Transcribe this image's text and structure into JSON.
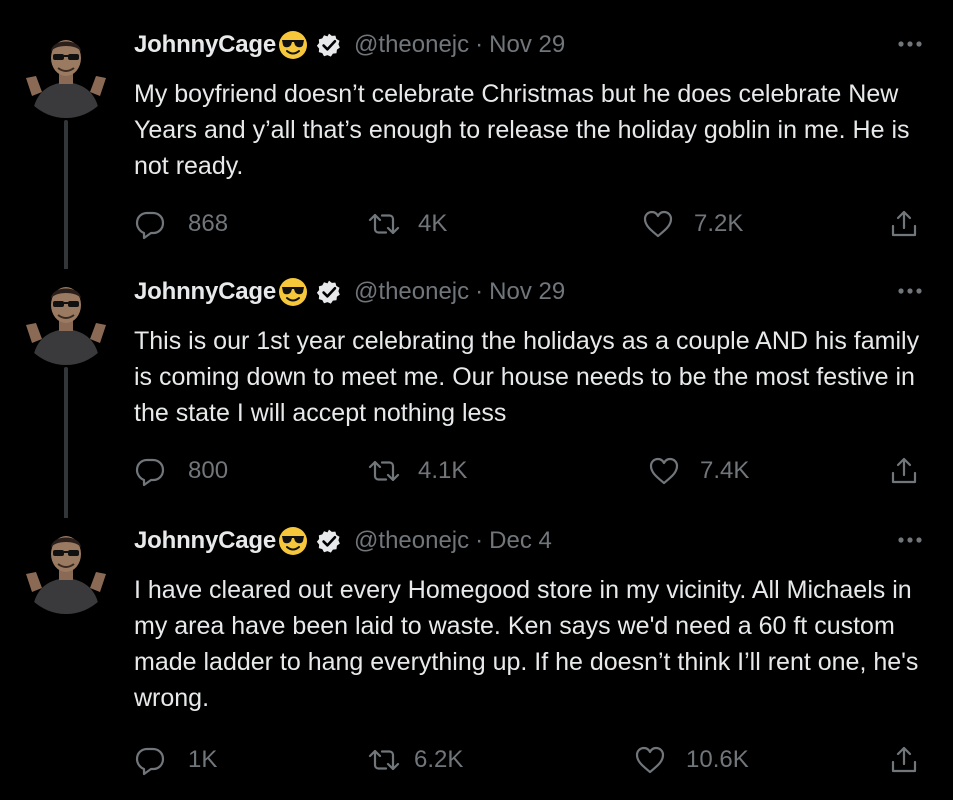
{
  "tweets": [
    {
      "name": "JohnnyCage",
      "handle": "@theonejc",
      "separator": "·",
      "date": "Nov 29",
      "text": "My boyfriend doesn’t celebrate Christmas but he does celebrate New Years and y’all that’s enough to release the holiday goblin in me. He is not ready.",
      "replies": "868",
      "retweets": "4K",
      "likes": "7.2K"
    },
    {
      "name": "JohnnyCage",
      "handle": "@theonejc",
      "separator": "·",
      "date": "Nov 29",
      "text": "This is our 1st year celebrating the holidays as a couple AND his family is coming down to meet me. Our house needs to be the most festive in the state I will accept nothing less",
      "replies": "800",
      "retweets": "4.1K",
      "likes": "7.4K"
    },
    {
      "name": "JohnnyCage",
      "handle": "@theonejc",
      "separator": "·",
      "date": "Dec 4",
      "text": "I have cleared out every Homegood store in my vicinity. All Michaels in my area have been laid to waste. Ken says we'd need a 60 ft custom made ladder to hang everything up. If he doesn’t think I’ll rent one, he's wrong.",
      "replies": "1K",
      "retweets": "6.2K",
      "likes": "10.6K"
    }
  ],
  "icons": {
    "name_emoji": "smiling-face-with-sunglasses-icon",
    "verified": "verified-badge-icon",
    "more": "more-options-icon",
    "reply": "reply-icon",
    "retweet": "retweet-icon",
    "like": "heart-icon",
    "share": "share-icon"
  },
  "colors": {
    "background": "#000000",
    "text": "#e7e9ea",
    "muted": "#71767b",
    "thread_line": "#333639",
    "emoji": "#f6c73b"
  }
}
